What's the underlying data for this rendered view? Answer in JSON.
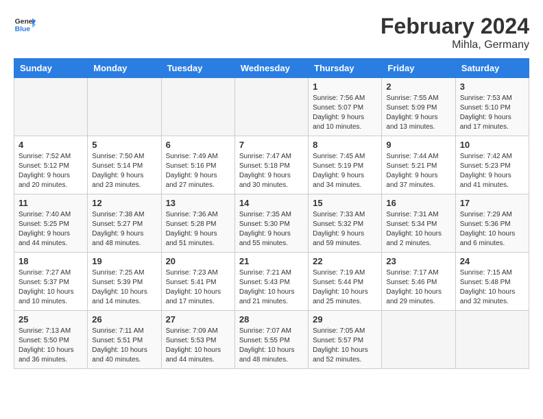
{
  "header": {
    "logo_general": "General",
    "logo_blue": "Blue",
    "month_year": "February 2024",
    "location": "Mihla, Germany"
  },
  "days_of_week": [
    "Sunday",
    "Monday",
    "Tuesday",
    "Wednesday",
    "Thursday",
    "Friday",
    "Saturday"
  ],
  "weeks": [
    [
      {
        "day": "",
        "sunrise": "",
        "sunset": "",
        "daylight": ""
      },
      {
        "day": "",
        "sunrise": "",
        "sunset": "",
        "daylight": ""
      },
      {
        "day": "",
        "sunrise": "",
        "sunset": "",
        "daylight": ""
      },
      {
        "day": "",
        "sunrise": "",
        "sunset": "",
        "daylight": ""
      },
      {
        "day": "1",
        "sunrise": "Sunrise: 7:56 AM",
        "sunset": "Sunset: 5:07 PM",
        "daylight": "Daylight: 9 hours and 10 minutes."
      },
      {
        "day": "2",
        "sunrise": "Sunrise: 7:55 AM",
        "sunset": "Sunset: 5:09 PM",
        "daylight": "Daylight: 9 hours and 13 minutes."
      },
      {
        "day": "3",
        "sunrise": "Sunrise: 7:53 AM",
        "sunset": "Sunset: 5:10 PM",
        "daylight": "Daylight: 9 hours and 17 minutes."
      }
    ],
    [
      {
        "day": "4",
        "sunrise": "Sunrise: 7:52 AM",
        "sunset": "Sunset: 5:12 PM",
        "daylight": "Daylight: 9 hours and 20 minutes."
      },
      {
        "day": "5",
        "sunrise": "Sunrise: 7:50 AM",
        "sunset": "Sunset: 5:14 PM",
        "daylight": "Daylight: 9 hours and 23 minutes."
      },
      {
        "day": "6",
        "sunrise": "Sunrise: 7:49 AM",
        "sunset": "Sunset: 5:16 PM",
        "daylight": "Daylight: 9 hours and 27 minutes."
      },
      {
        "day": "7",
        "sunrise": "Sunrise: 7:47 AM",
        "sunset": "Sunset: 5:18 PM",
        "daylight": "Daylight: 9 hours and 30 minutes."
      },
      {
        "day": "8",
        "sunrise": "Sunrise: 7:45 AM",
        "sunset": "Sunset: 5:19 PM",
        "daylight": "Daylight: 9 hours and 34 minutes."
      },
      {
        "day": "9",
        "sunrise": "Sunrise: 7:44 AM",
        "sunset": "Sunset: 5:21 PM",
        "daylight": "Daylight: 9 hours and 37 minutes."
      },
      {
        "day": "10",
        "sunrise": "Sunrise: 7:42 AM",
        "sunset": "Sunset: 5:23 PM",
        "daylight": "Daylight: 9 hours and 41 minutes."
      }
    ],
    [
      {
        "day": "11",
        "sunrise": "Sunrise: 7:40 AM",
        "sunset": "Sunset: 5:25 PM",
        "daylight": "Daylight: 9 hours and 44 minutes."
      },
      {
        "day": "12",
        "sunrise": "Sunrise: 7:38 AM",
        "sunset": "Sunset: 5:27 PM",
        "daylight": "Daylight: 9 hours and 48 minutes."
      },
      {
        "day": "13",
        "sunrise": "Sunrise: 7:36 AM",
        "sunset": "Sunset: 5:28 PM",
        "daylight": "Daylight: 9 hours and 51 minutes."
      },
      {
        "day": "14",
        "sunrise": "Sunrise: 7:35 AM",
        "sunset": "Sunset: 5:30 PM",
        "daylight": "Daylight: 9 hours and 55 minutes."
      },
      {
        "day": "15",
        "sunrise": "Sunrise: 7:33 AM",
        "sunset": "Sunset: 5:32 PM",
        "daylight": "Daylight: 9 hours and 59 minutes."
      },
      {
        "day": "16",
        "sunrise": "Sunrise: 7:31 AM",
        "sunset": "Sunset: 5:34 PM",
        "daylight": "Daylight: 10 hours and 2 minutes."
      },
      {
        "day": "17",
        "sunrise": "Sunrise: 7:29 AM",
        "sunset": "Sunset: 5:36 PM",
        "daylight": "Daylight: 10 hours and 6 minutes."
      }
    ],
    [
      {
        "day": "18",
        "sunrise": "Sunrise: 7:27 AM",
        "sunset": "Sunset: 5:37 PM",
        "daylight": "Daylight: 10 hours and 10 minutes."
      },
      {
        "day": "19",
        "sunrise": "Sunrise: 7:25 AM",
        "sunset": "Sunset: 5:39 PM",
        "daylight": "Daylight: 10 hours and 14 minutes."
      },
      {
        "day": "20",
        "sunrise": "Sunrise: 7:23 AM",
        "sunset": "Sunset: 5:41 PM",
        "daylight": "Daylight: 10 hours and 17 minutes."
      },
      {
        "day": "21",
        "sunrise": "Sunrise: 7:21 AM",
        "sunset": "Sunset: 5:43 PM",
        "daylight": "Daylight: 10 hours and 21 minutes."
      },
      {
        "day": "22",
        "sunrise": "Sunrise: 7:19 AM",
        "sunset": "Sunset: 5:44 PM",
        "daylight": "Daylight: 10 hours and 25 minutes."
      },
      {
        "day": "23",
        "sunrise": "Sunrise: 7:17 AM",
        "sunset": "Sunset: 5:46 PM",
        "daylight": "Daylight: 10 hours and 29 minutes."
      },
      {
        "day": "24",
        "sunrise": "Sunrise: 7:15 AM",
        "sunset": "Sunset: 5:48 PM",
        "daylight": "Daylight: 10 hours and 32 minutes."
      }
    ],
    [
      {
        "day": "25",
        "sunrise": "Sunrise: 7:13 AM",
        "sunset": "Sunset: 5:50 PM",
        "daylight": "Daylight: 10 hours and 36 minutes."
      },
      {
        "day": "26",
        "sunrise": "Sunrise: 7:11 AM",
        "sunset": "Sunset: 5:51 PM",
        "daylight": "Daylight: 10 hours and 40 minutes."
      },
      {
        "day": "27",
        "sunrise": "Sunrise: 7:09 AM",
        "sunset": "Sunset: 5:53 PM",
        "daylight": "Daylight: 10 hours and 44 minutes."
      },
      {
        "day": "28",
        "sunrise": "Sunrise: 7:07 AM",
        "sunset": "Sunset: 5:55 PM",
        "daylight": "Daylight: 10 hours and 48 minutes."
      },
      {
        "day": "29",
        "sunrise": "Sunrise: 7:05 AM",
        "sunset": "Sunset: 5:57 PM",
        "daylight": "Daylight: 10 hours and 52 minutes."
      },
      {
        "day": "",
        "sunrise": "",
        "sunset": "",
        "daylight": ""
      },
      {
        "day": "",
        "sunrise": "",
        "sunset": "",
        "daylight": ""
      }
    ]
  ]
}
